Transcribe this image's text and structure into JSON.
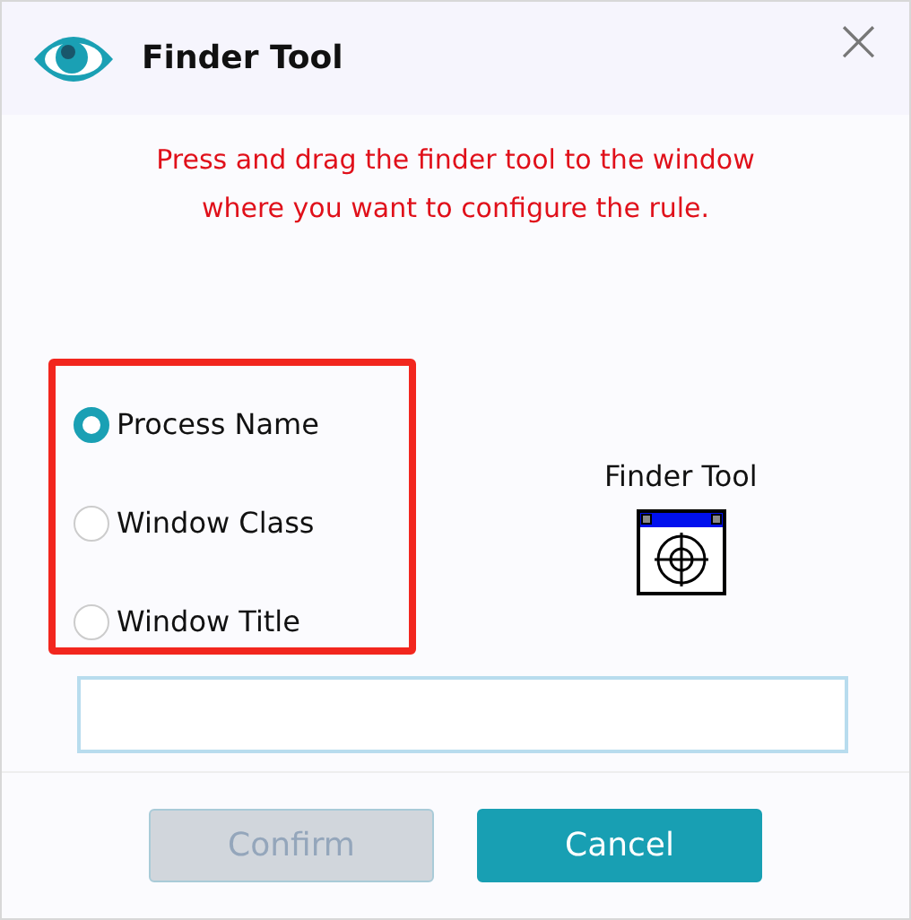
{
  "window": {
    "title": "Finder Tool",
    "close": "×"
  },
  "instruction": "Press and drag the finder tool to the window where you want to configure the rule.",
  "options": [
    {
      "label": "Process Name",
      "selected": true
    },
    {
      "label": "Window Class",
      "selected": false
    },
    {
      "label": "Window Title",
      "selected": false
    }
  ],
  "finder": {
    "label": "Finder Tool"
  },
  "buttons": [
    {
      "label": "Confirm",
      "kind": "secondary",
      "disabled": true
    },
    {
      "label": "Cancel",
      "kind": "primary",
      "disabled": false
    }
  ]
}
